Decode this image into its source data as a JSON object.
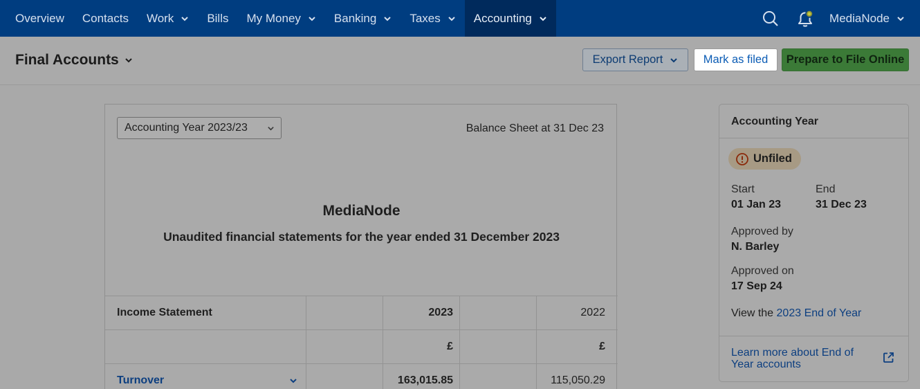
{
  "nav": {
    "items": [
      {
        "label": "Overview",
        "dropdown": false,
        "active": false
      },
      {
        "label": "Contacts",
        "dropdown": false,
        "active": false
      },
      {
        "label": "Work",
        "dropdown": true,
        "active": false
      },
      {
        "label": "Bills",
        "dropdown": false,
        "active": false
      },
      {
        "label": "My Money",
        "dropdown": true,
        "active": false
      },
      {
        "label": "Banking",
        "dropdown": true,
        "active": false
      },
      {
        "label": "Taxes",
        "dropdown": true,
        "active": false
      },
      {
        "label": "Accounting",
        "dropdown": true,
        "active": true
      }
    ],
    "user": "MediaNode"
  },
  "header": {
    "title": "Final Accounts",
    "export_label": "Export Report",
    "mark_filed_label": "Mark as filed",
    "prepare_label": "Prepare to File Online"
  },
  "report": {
    "year_select": "Accounting Year 2023/23",
    "balance_sheet": "Balance Sheet at 31 Dec 23",
    "company": "MediaNode",
    "subtitle": "Unaudited financial statements for the year ended 31 December 2023",
    "table": {
      "header": {
        "label": "Income Statement",
        "col_a": "2023",
        "col_b": "2022"
      },
      "currency": {
        "col_a": "£",
        "col_b": "£"
      },
      "rows": [
        {
          "label": "Turnover",
          "col_a": "163,015.85",
          "col_b": "115,050.29"
        }
      ]
    }
  },
  "side": {
    "title": "Accounting Year",
    "status": "Unfiled",
    "start_label": "Start",
    "start_value": "01 Jan 23",
    "end_label": "End",
    "end_value": "31 Dec 23",
    "approved_by_label": "Approved by",
    "approved_by_value": "N. Barley",
    "approved_on_label": "Approved on",
    "approved_on_value": "17 Sep 24",
    "view_prefix": "View the",
    "view_link": "2023 End of Year",
    "learn_more": "Learn more about End of Year accounts"
  },
  "colors": {
    "nav_bg": "#003d80",
    "nav_active": "#002a5c",
    "primary_button": "#3b7a37",
    "link": "#0d3f80",
    "status_badge": "#a79a84"
  }
}
